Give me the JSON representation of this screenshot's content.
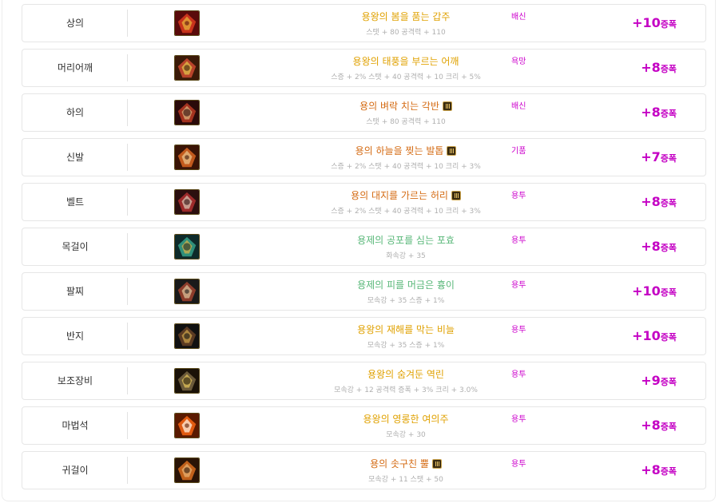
{
  "items": [
    {
      "slot": "상의",
      "name": "용왕의 봄을 품는 갑주",
      "grade": "epic",
      "badge": false,
      "stats": "스탯 + 80 공격력 + 110",
      "tag": "배신",
      "amp_value": "+10",
      "amp_unit": "증폭",
      "icon": "dragon-armor-top-icon",
      "palette": [
        "#5a0b0b",
        "#c8331c",
        "#e6b23a"
      ]
    },
    {
      "slot": "머리어깨",
      "name": "용왕의 태풍을 부르는 어깨",
      "grade": "epic",
      "badge": false,
      "stats": "스증 + 2% 스탯 + 40 공격력 + 10 크리 + 5%",
      "tag": "욕망",
      "amp_value": "+8",
      "amp_unit": "증폭",
      "icon": "dragon-shoulder-icon",
      "palette": [
        "#3b1a08",
        "#b8432a",
        "#e2c04a"
      ]
    },
    {
      "slot": "하의",
      "name": "용의 벼락 치는 각반",
      "grade": "legend",
      "badge": true,
      "stats": "스탯 + 80 공격력 + 110",
      "tag": "배신",
      "amp_value": "+8",
      "amp_unit": "증폭",
      "icon": "dragon-pants-icon",
      "palette": [
        "#2a0a0a",
        "#a3321f",
        "#d9b27c"
      ]
    },
    {
      "slot": "신발",
      "name": "용의 하늘을 찢는 발톱",
      "grade": "legend",
      "badge": true,
      "stats": "스증 + 2% 스탯 + 40 공격력 + 10 크리 + 3%",
      "tag": "기품",
      "amp_value": "+7",
      "amp_unit": "증폭",
      "icon": "dragon-boots-icon",
      "palette": [
        "#3a1406",
        "#c25a1d",
        "#e9c38a"
      ]
    },
    {
      "slot": "벨트",
      "name": "용의 대지를 가르는 허리",
      "grade": "legend",
      "badge": true,
      "stats": "스증 + 2% 스탯 + 40 공격력 + 10 크리 + 3%",
      "tag": "용투",
      "amp_value": "+8",
      "amp_unit": "증폭",
      "icon": "dragon-belt-icon",
      "palette": [
        "#2b0f0f",
        "#9c2a2a",
        "#d6c3b0"
      ]
    },
    {
      "slot": "목걸이",
      "name": "용제의 공포를 심는 포효",
      "grade": "unique",
      "badge": false,
      "stats": "화속강 + 35",
      "tag": "용투",
      "amp_value": "+8",
      "amp_unit": "증폭",
      "icon": "dragon-necklace-icon",
      "palette": [
        "#0e2a2a",
        "#2f8f7a",
        "#d6b24a"
      ]
    },
    {
      "slot": "팔찌",
      "name": "용제의 피를 머금은 흉이",
      "grade": "unique",
      "badge": false,
      "stats": "모속강 + 35 스증 + 1%",
      "tag": "용투",
      "amp_value": "+10",
      "amp_unit": "증폭",
      "icon": "dragon-bracelet-icon",
      "palette": [
        "#1a1a1a",
        "#8c3b2a",
        "#d9c09a"
      ]
    },
    {
      "slot": "반지",
      "name": "용왕의 재해를 막는 비늘",
      "grade": "epic",
      "badge": false,
      "stats": "모속강 + 35 스증 + 1%",
      "tag": "용투",
      "amp_value": "+10",
      "amp_unit": "증폭",
      "icon": "dragon-ring-icon",
      "palette": [
        "#111111",
        "#5a3a22",
        "#caa04a"
      ]
    },
    {
      "slot": "보조장비",
      "name": "용왕의 숨겨둔 역린",
      "grade": "epic",
      "badge": false,
      "stats": "모속강 + 12 공격력 증폭 + 3% 크리 + 3.0%",
      "tag": "용투",
      "amp_value": "+9",
      "amp_unit": "증폭",
      "icon": "dragon-scale-subequip-icon",
      "palette": [
        "#1a1208",
        "#6b5a3a",
        "#e0c25a"
      ]
    },
    {
      "slot": "마법석",
      "name": "용왕의 영롱한 여의주",
      "grade": "epic",
      "badge": false,
      "stats": "모속강 + 30",
      "tag": "용투",
      "amp_value": "+8",
      "amp_unit": "증폭",
      "icon": "dragon-orb-icon",
      "palette": [
        "#5a1a00",
        "#e05a10",
        "#fff2e0"
      ]
    },
    {
      "slot": "귀걸이",
      "name": "용의 솟구친 뿔",
      "grade": "legend",
      "badge": true,
      "stats": "모속강 + 11 스탯 + 50",
      "tag": "용투",
      "amp_value": "+8",
      "amp_unit": "증폭",
      "icon": "dragon-earring-icon",
      "palette": [
        "#2a1406",
        "#c0601a",
        "#e8b070"
      ]
    }
  ]
}
